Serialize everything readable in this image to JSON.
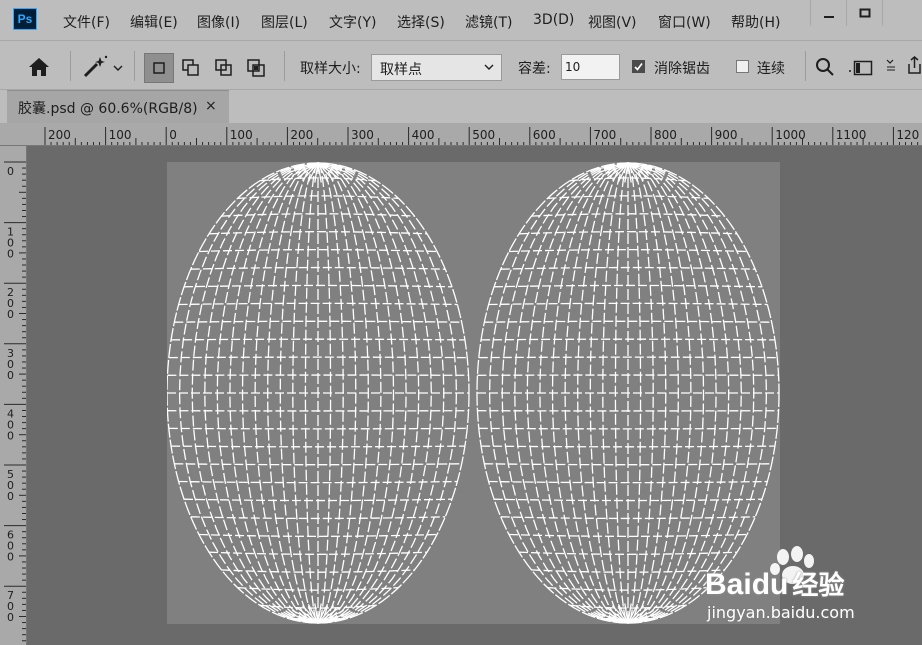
{
  "app": {
    "logo_text": "Ps"
  },
  "menu": {
    "items": [
      "文件(F)",
      "编辑(E)",
      "图像(I)",
      "图层(L)",
      "文字(Y)",
      "选择(S)",
      "滤镜(T)",
      "3D(D)",
      "视图(V)",
      "窗口(W)",
      "帮助(H)"
    ]
  },
  "window_controls": {
    "minimize_icon": "minimize-icon",
    "restore_icon": "restore-icon"
  },
  "options": {
    "home_icon": "home-icon",
    "tool_icon": "magic-wand-icon",
    "sample_size_label": "取样大小:",
    "sample_size_value": "取样点",
    "tolerance_label": "容差:",
    "tolerance_value": "10",
    "antialias_label": "消除锯齿",
    "antialias_checked": true,
    "contiguous_label": "连续",
    "contiguous_checked": false
  },
  "document": {
    "tab_title": "胶囊.psd @ 60.6%(RGB/8)",
    "close_glyph": "×"
  },
  "ruler": {
    "h_labels": [
      "200",
      "100",
      "0",
      "100",
      "200",
      "300",
      "400",
      "500",
      "600",
      "700",
      "800",
      "900",
      "1000",
      "1100",
      "120"
    ],
    "v_labels": [
      [
        "0"
      ],
      [
        "1",
        "0",
        "0"
      ],
      [
        "2",
        "0",
        "0"
      ],
      [
        "3",
        "0",
        "0"
      ],
      [
        "4",
        "0",
        "0"
      ],
      [
        "5",
        "0",
        "0"
      ],
      [
        "6",
        "0",
        "0"
      ],
      [
        "7",
        "0",
        "0"
      ]
    ]
  },
  "colors": {
    "ui_bg": "#bdbdbd",
    "workspace_bg": "#6a6a6a",
    "document_bg": "#808080",
    "mesh_line": "#ffffff",
    "watermark_red": "#de2021",
    "watermark_blue": "#2932e1"
  },
  "watermark": {
    "brand_left": "Bai",
    "brand_right": "du",
    "brand_cn": "经验",
    "url": "jingyan.baidu.com"
  }
}
